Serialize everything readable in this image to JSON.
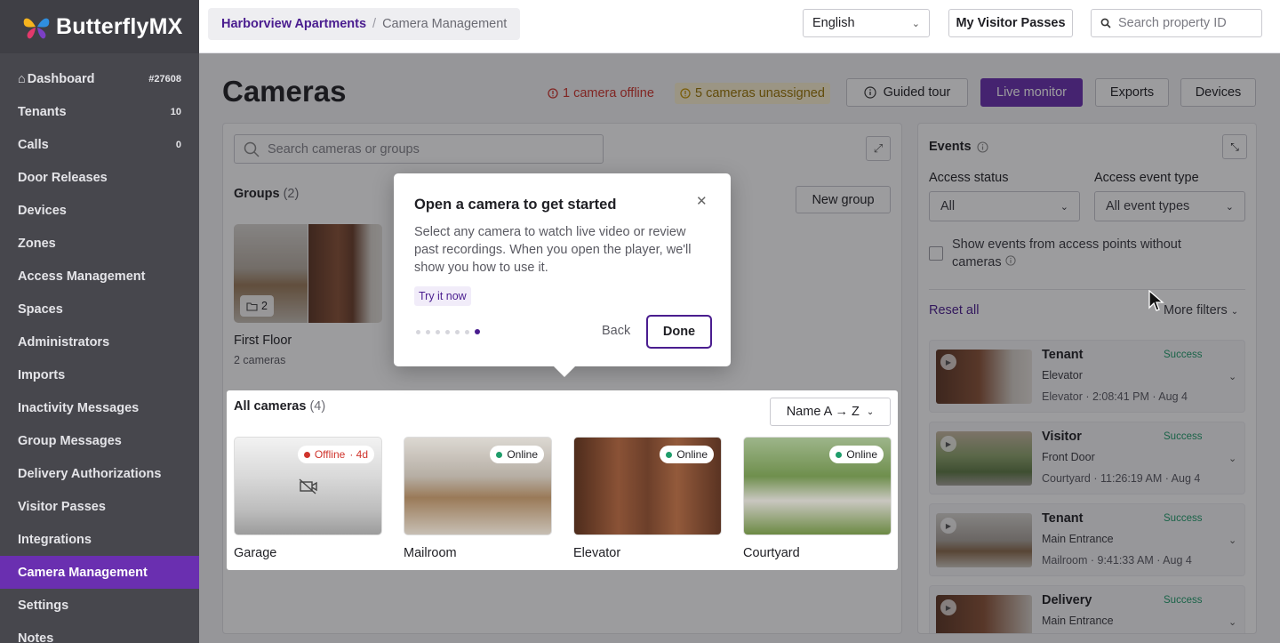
{
  "brand": {
    "name": "ButterflyMX"
  },
  "sidebar": {
    "items": [
      {
        "label": "Dashboard",
        "count": "#27608",
        "icon": "home-icon"
      },
      {
        "label": "Tenants",
        "count": "10"
      },
      {
        "label": "Calls",
        "count": "0"
      },
      {
        "label": "Door Releases"
      },
      {
        "label": "Devices"
      },
      {
        "label": "Zones"
      },
      {
        "label": "Access Management"
      },
      {
        "label": "Spaces"
      },
      {
        "label": "Administrators"
      },
      {
        "label": "Imports"
      },
      {
        "label": "Inactivity Messages"
      },
      {
        "label": "Group Messages"
      },
      {
        "label": "Delivery Authorizations"
      },
      {
        "label": "Visitor Passes"
      },
      {
        "label": "Integrations"
      },
      {
        "label": "Camera Management",
        "active": true
      },
      {
        "label": "Settings"
      },
      {
        "label": "Notes"
      }
    ]
  },
  "topbar": {
    "breadcrumb": {
      "property": "Harborview Apartments",
      "separator": "/",
      "page": "Camera Management"
    },
    "language": "English",
    "visitor_passes_label": "My Visitor Passes",
    "search_placeholder": "Search property ID"
  },
  "header": {
    "title": "Cameras",
    "offline_badge": "1 camera offline",
    "unassigned_badge": "5 cameras unassigned",
    "guided_tour": "Guided tour",
    "live_monitor": "Live monitor",
    "exports": "Exports",
    "devices": "Devices"
  },
  "camera_panel": {
    "search_placeholder": "Search cameras or groups",
    "groups_label": "Groups",
    "groups_count": "(2)",
    "new_group": "New group",
    "group": {
      "count": "2",
      "name": "First Floor",
      "sub": "2 cameras"
    },
    "all_cameras_label": "All cameras",
    "all_cameras_count": "(4)",
    "sort_label": "Name A → Z",
    "cameras": [
      {
        "name": "Garage",
        "status": "Offline",
        "extra": "· 4d",
        "status_color": "#d0342c"
      },
      {
        "name": "Mailroom",
        "status": "Online",
        "extra": "",
        "status_color": "#1f9d6b"
      },
      {
        "name": "Elevator",
        "status": "Online",
        "extra": "",
        "status_color": "#1f9d6b"
      },
      {
        "name": "Courtyard",
        "status": "Online",
        "extra": "",
        "status_color": "#1f9d6b"
      }
    ]
  },
  "events": {
    "title": "Events",
    "access_status_label": "Access status",
    "access_status_value": "All",
    "event_type_label": "Access event type",
    "event_type_value": "All event types",
    "checkbox_label": "Show events from access points without cameras",
    "reset": "Reset all",
    "more_filters": "More filters",
    "items": [
      {
        "who": "Tenant",
        "status": "Success",
        "door": "Elevator",
        "meta": "Elevator · 2:08:41 PM · Aug 4"
      },
      {
        "who": "Visitor",
        "status": "Success",
        "door": "Front Door",
        "meta": "Courtyard · 11:26:19 AM · Aug 4"
      },
      {
        "who": "Tenant",
        "status": "Success",
        "door": "Main Entrance",
        "meta": "Mailroom · 9:41:33 AM · Aug 4"
      },
      {
        "who": "Delivery",
        "status": "Success",
        "door": "Main Entrance",
        "meta": ""
      }
    ]
  },
  "popover": {
    "title": "Open a camera to get started",
    "body": "Select any camera to watch live video or review past recordings. When you open the player, we'll show you how to use it.",
    "try_label": "Try it now",
    "back": "Back",
    "done": "Done",
    "steps_total": 7,
    "step_current": 7
  },
  "colors": {
    "accent": "#6a2fb0",
    "sidebar": "#47474d",
    "online": "#1f9d6b",
    "offline": "#d0342c"
  }
}
